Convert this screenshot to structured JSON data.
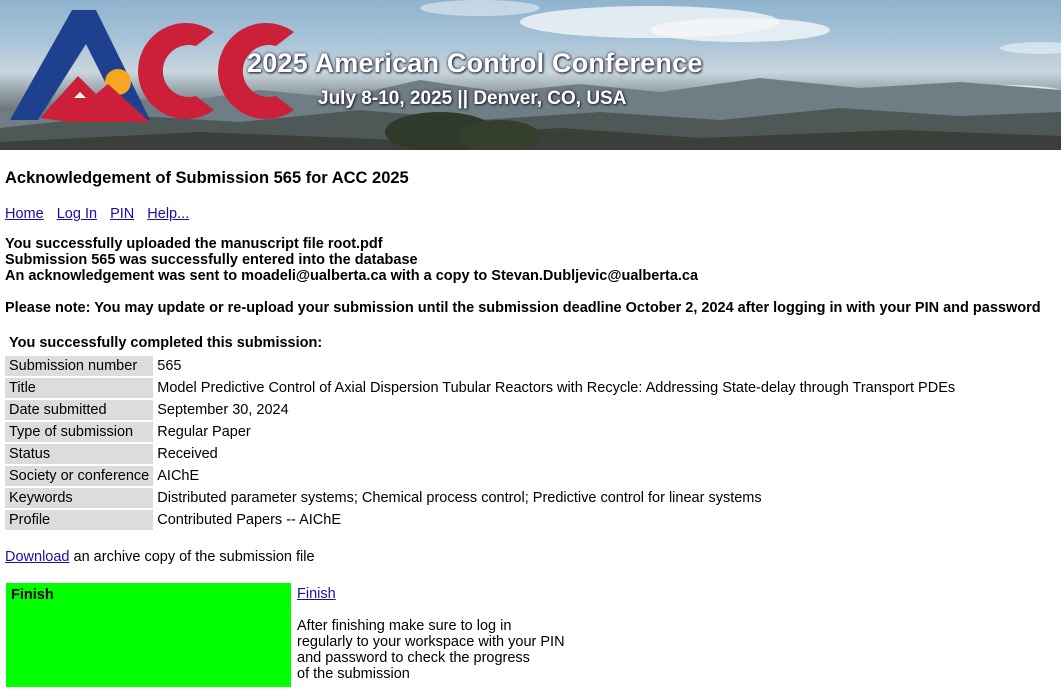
{
  "banner": {
    "logo_text": "ACC",
    "conference_title": "2025 American Control Conference",
    "conference_subtitle": "July 8-10, 2025 || Denver, CO, USA",
    "colors": {
      "logo_blue": "#1f3f8f",
      "logo_red": "#cc1f3a",
      "sun": "#f5a623"
    }
  },
  "page": {
    "title": "Acknowledgement of Submission 565 for ACC 2025"
  },
  "nav": {
    "home": "Home",
    "login": "Log In",
    "pin": "PIN",
    "help": "Help..."
  },
  "messages": {
    "upload": "You successfully uploaded the manuscript file root.pdf",
    "entered": "Submission 565 was successfully entered into the database",
    "ack": "An acknowledgement was sent to moadeli@ualberta.ca with a copy to Stevan.Dubljevic@ualberta.ca",
    "note": "Please note: You may update or re-upload your submission until the submission deadline October 2, 2024 after logging in with your PIN and password"
  },
  "summary": {
    "heading": "You successfully completed this submission:",
    "rows": [
      {
        "label": "Submission number",
        "value": "565"
      },
      {
        "label": "Title",
        "value": "Model Predictive Control of Axial Dispersion Tubular Reactors with Recycle: Addressing State-delay through Transport PDEs"
      },
      {
        "label": "Date submitted",
        "value": "September 30, 2024"
      },
      {
        "label": "Type of submission",
        "value": "Regular Paper"
      },
      {
        "label": "Status",
        "value": "Received"
      },
      {
        "label": "Society or conference",
        "value": "AIChE"
      },
      {
        "label": "Keywords",
        "value": "Distributed parameter systems; Chemical process control; Predictive control for linear systems"
      },
      {
        "label": "Profile",
        "value": "Contributed Papers -- AIChE"
      }
    ]
  },
  "download": {
    "link": "Download",
    "text": " an archive copy of the submission file"
  },
  "finish": {
    "box_label": "Finish",
    "link": "Finish",
    "note_lines": [
      "After finishing make sure to log in",
      "regularly to your workspace with your PIN",
      "and password to check the progress",
      "of the submission"
    ],
    "box_color": "#00ff00"
  }
}
